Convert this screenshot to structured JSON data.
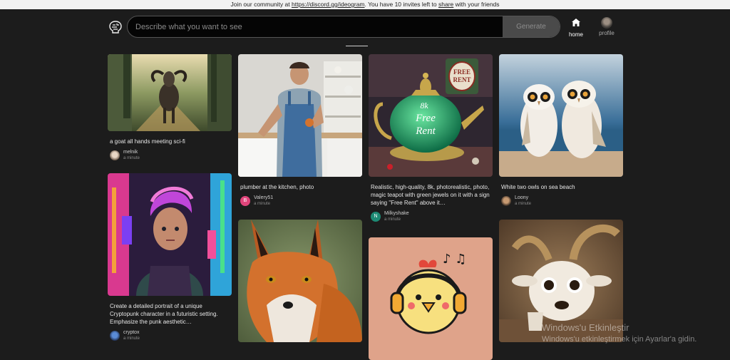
{
  "banner": {
    "text_before": "Join our community at ",
    "link": "https://discord.gg/ideogram",
    "text_middle": ". You have 10 invites left to ",
    "share": "share",
    "text_after": " with your friends"
  },
  "search": {
    "placeholder": "Describe what you want to see",
    "generate_label": "Generate"
  },
  "nav": {
    "home_label": "home",
    "profile_label": "profile"
  },
  "cards": [
    {
      "caption": "a goat all hands meeting sci-fi",
      "author": "melnik",
      "time": "a minute",
      "avatar_letter": ""
    },
    {
      "caption": "plumber at the kitchen, photo",
      "author": "Valery51",
      "time": "a minute",
      "avatar_letter": "B"
    },
    {
      "caption": "Realistic, high-quality, 8k, photorealistic, photo, magic teapot with green jewels on it with a sign saying \"Free Rent\" above it…",
      "author": "Milkyshake",
      "time": "a minute",
      "avatar_letter": "N"
    },
    {
      "caption": "White two owls on sea beach",
      "author": "Loony",
      "time": "a minute",
      "avatar_letter": ""
    },
    {
      "caption": "Create a detailed portrait of a unique Cryptopunk character in a futuristic setting. Emphasize the punk aesthetic…",
      "author": "cryptox",
      "time": "a minute",
      "avatar_letter": ""
    }
  ],
  "teapot_sign": {
    "line1": "8k",
    "line2": "Free",
    "line3": "Rent"
  },
  "wall_sign": {
    "line1": "FREE",
    "line2": "RENT"
  },
  "watermark": {
    "line1": "Windows'u Etkinleştir",
    "line2": "Windows'u etkinleştirmek için Ayarlar'a gidin."
  },
  "colors": {
    "background": "#1c1c1c",
    "banner": "#f2f2f2",
    "avatar_pink": "#e0457b",
    "avatar_teal": "#1d8a74"
  }
}
